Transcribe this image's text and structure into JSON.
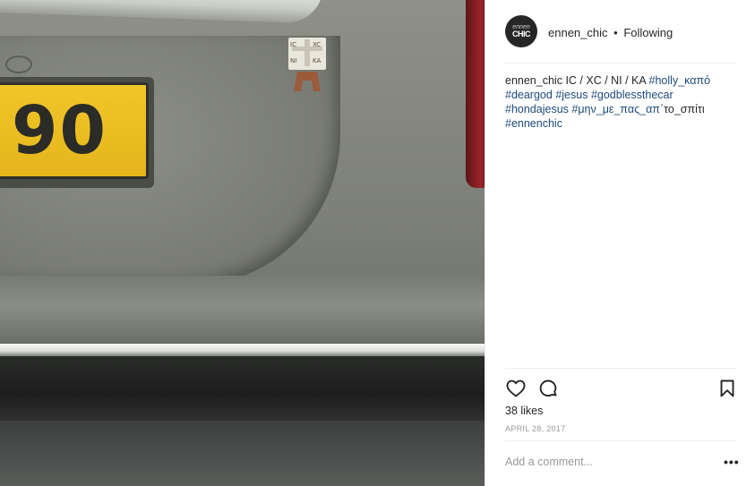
{
  "post": {
    "plate_text": "90",
    "sticker_text": "IC XC NI KA"
  },
  "header": {
    "avatar_line1": "ennen",
    "avatar_line2": "CHIC",
    "username": "ennen_chic",
    "separator": "•",
    "follow_status": "Following"
  },
  "caption": {
    "username": "ennen_chic",
    "text": "IC / XC / NI / KA",
    "tags": [
      "#holly_καπό",
      "#deargod",
      "#jesus",
      "#godblessthecar",
      "#hondajesus",
      "#μην_με_πας_απ"
    ],
    "trailing_text": "΄το_σπίτι",
    "last_tag": "#ennenchic"
  },
  "actions": {
    "like_icon": "heart-icon",
    "comment_icon": "speech-bubble-icon",
    "save_icon": "bookmark-icon"
  },
  "likes": "38 likes",
  "date": "APRIL 28, 2017",
  "comment": {
    "placeholder": "Add a comment...",
    "more_label": "•••"
  }
}
